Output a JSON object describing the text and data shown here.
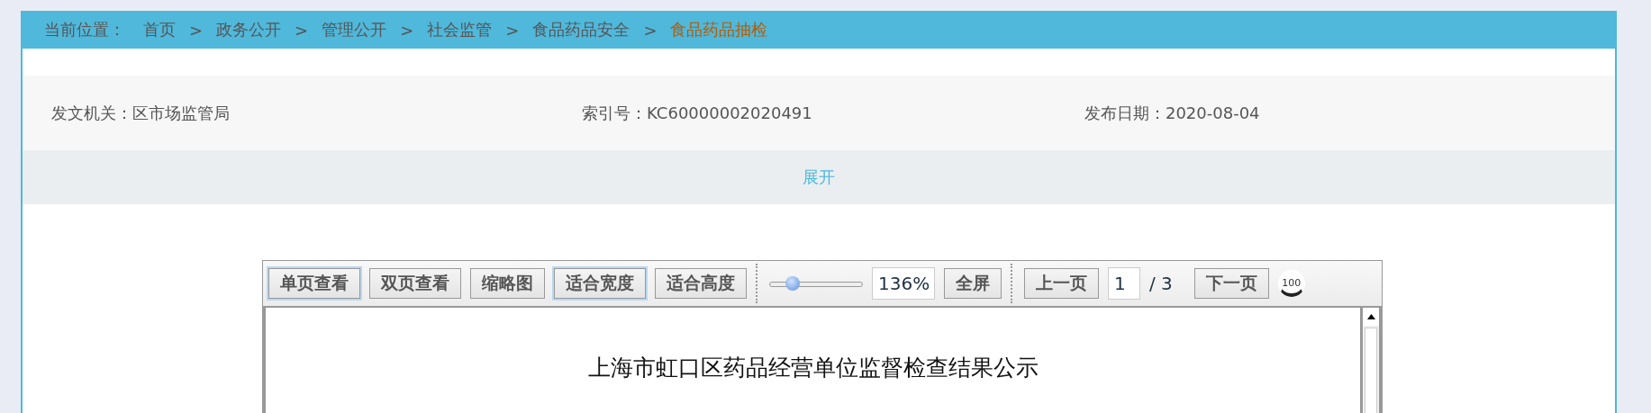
{
  "breadcrumb": {
    "label": "当前位置：",
    "items": [
      {
        "text": "首页",
        "current": false
      },
      {
        "text": "政务公开",
        "current": false
      },
      {
        "text": "管理公开",
        "current": false
      },
      {
        "text": "社会监管",
        "current": false
      },
      {
        "text": "食品药品安全",
        "current": false
      },
      {
        "text": "食品药品抽检",
        "current": true
      }
    ],
    "separator": ">"
  },
  "info": [
    {
      "label": "发文机关：",
      "value": "区市场监管局"
    },
    {
      "label": "索引号：",
      "value": "KC60000002020491"
    },
    {
      "label": "发布日期：",
      "value": "2020-08-04"
    }
  ],
  "expand": "展开",
  "viewer": {
    "view_buttons": [
      {
        "label": "单页查看",
        "selected": true
      },
      {
        "label": "双页查看",
        "selected": false
      },
      {
        "label": "缩略图",
        "selected": false
      },
      {
        "label": "适合宽度",
        "selected": true
      },
      {
        "label": "适合高度",
        "selected": false
      }
    ],
    "zoom": {
      "level": 0.25,
      "value": "136%"
    },
    "fullscreen": "全屏",
    "prev": "上一页",
    "page": "1",
    "total": "/ 3",
    "next": "下一页",
    "actual_size": "100",
    "document_title": "上海市虹口区药品经营单位监督检查结果公示"
  }
}
